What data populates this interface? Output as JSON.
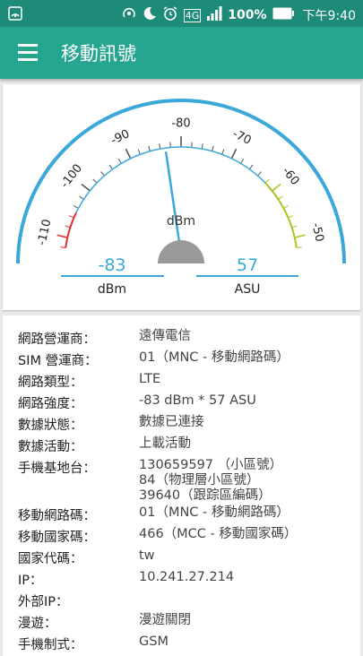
{
  "status": {
    "battery": "100%",
    "time": "下午9:40",
    "network": "4G"
  },
  "appbar": {
    "title": "移動訊號"
  },
  "gauge": {
    "unit": "dBm",
    "tick_labels": [
      "-110",
      "-100",
      "-90",
      "-80",
      "-70",
      "-60",
      "-50"
    ],
    "dbm_value": "-83",
    "dbm_label": "dBm",
    "asu_value": "57",
    "asu_label": "ASU",
    "needle_dbm": -83,
    "range_min": -115,
    "range_max": -45,
    "colors": {
      "arc": "#3aa8d8",
      "needle": "#3aa8d8",
      "low": "#e03030",
      "high": "#a8c820",
      "hub": "#999999",
      "value": "#3aa8d8"
    }
  },
  "info": [
    {
      "label": "網路營運商：",
      "value": [
        "遠傳電信"
      ]
    },
    {
      "label": "SIM 營運商：",
      "value": [
        "01（MNC - 移動網路碼）"
      ]
    },
    {
      "label": "網路類型：",
      "value": [
        "LTE"
      ]
    },
    {
      "label": "網路強度：",
      "value": [
        "-83 dBm * 57 ASU"
      ]
    },
    {
      "label": "數據狀態：",
      "value": [
        "數據已連接"
      ]
    },
    {
      "label": "數據活動：",
      "value": [
        "上載活動"
      ]
    },
    {
      "label": "手機基地台：",
      "value": [
        "130659597 （小區號）",
        "84（物理層小區號）",
        "39640（跟踪區編碼）"
      ]
    },
    {
      "label": "移動網路碼：",
      "value": [
        "01（MNC - 移動網路碼）"
      ]
    },
    {
      "label": "移動國家碼：",
      "value": [
        "466（MCC - 移動國家碼）"
      ]
    },
    {
      "label": "國家代碼：",
      "value": [
        "tw"
      ]
    },
    {
      "label": "IP：",
      "value": [
        "10.241.27.214"
      ]
    },
    {
      "label": "外部IP：",
      "value": []
    },
    {
      "label": "漫遊：",
      "value": [
        "漫遊關閉"
      ]
    },
    {
      "label": "手機制式：",
      "value": [
        "GSM"
      ]
    }
  ]
}
